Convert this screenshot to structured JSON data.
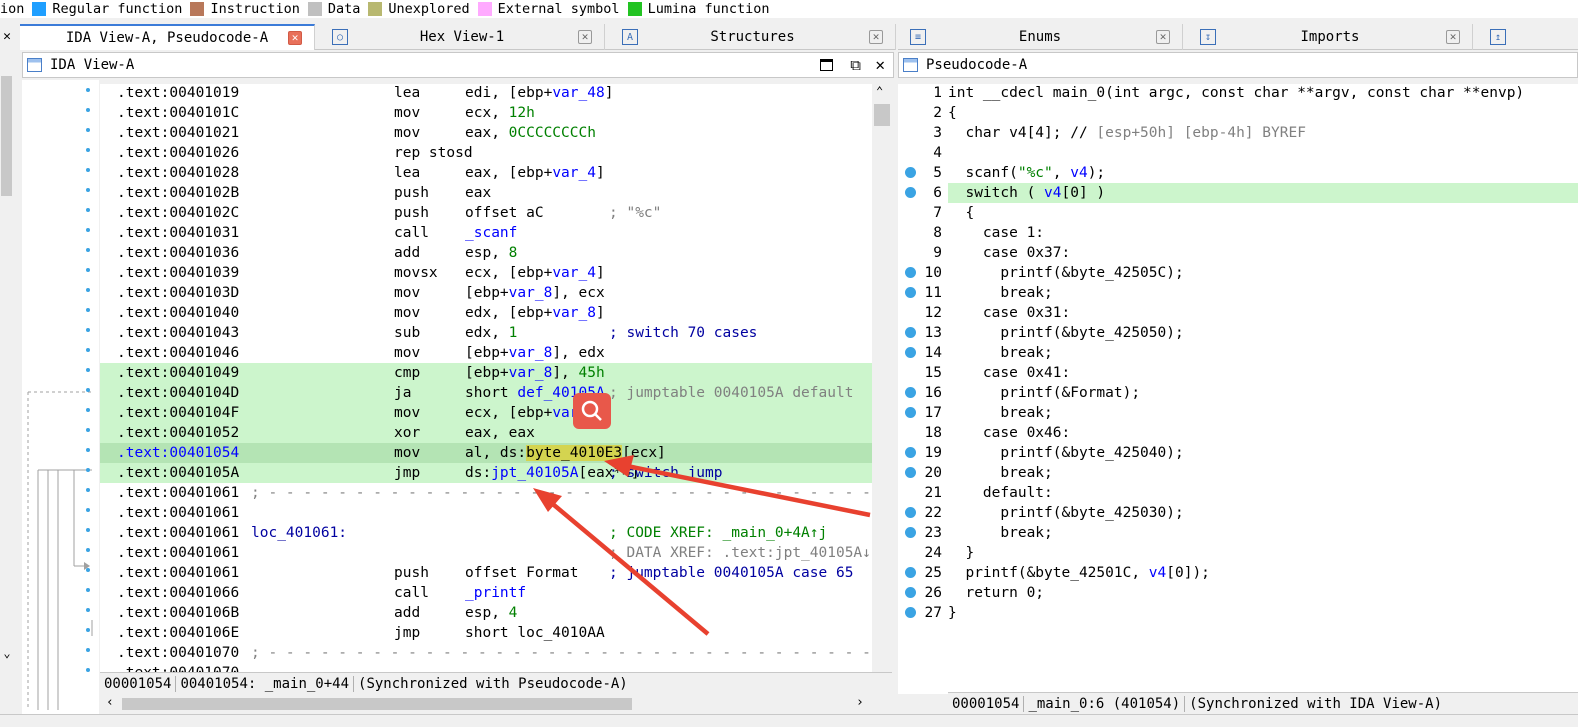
{
  "legend": [
    {
      "label": "ion",
      "color": ""
    },
    {
      "label": "Regular function",
      "color": "#1f9fff"
    },
    {
      "label": "Instruction",
      "color": "#b8785a"
    },
    {
      "label": "Data",
      "color": "#c0c0c0"
    },
    {
      "label": "Unexplored",
      "color": "#b8b870"
    },
    {
      "label": "External symbol",
      "color": "#ffaaff"
    },
    {
      "label": "Lumina function",
      "color": "#22c322"
    }
  ],
  "left_tabs": [
    {
      "label": "IDA View-A, Pseudocode-A",
      "active": true
    },
    {
      "label": "Hex View-1",
      "active": false
    },
    {
      "label": "Structures",
      "active": false
    }
  ],
  "right_tabs": [
    {
      "label": "Enums"
    },
    {
      "label": "Imports"
    }
  ],
  "ida_view": {
    "title": "IDA View-A",
    "lines": [
      {
        "addr": ".text:00401019",
        "label": "",
        "mn": "lea",
        "op": [
          [
            "edi, [ebp+",
            ""
          ],
          [
            "var_48",
            "blue"
          ],
          [
            "]",
            ""
          ]
        ],
        "cmt": []
      },
      {
        "addr": ".text:0040101C",
        "label": "",
        "mn": "mov",
        "op": [
          [
            "ecx, ",
            ""
          ],
          [
            "12h",
            "green"
          ]
        ],
        "cmt": []
      },
      {
        "addr": ".text:00401021",
        "label": "",
        "mn": "mov",
        "op": [
          [
            "eax, ",
            ""
          ],
          [
            "0CCCCCCCCh",
            "green"
          ]
        ],
        "cmt": []
      },
      {
        "addr": ".text:00401026",
        "label": "",
        "mn": "rep stosd",
        "op": [],
        "cmt": []
      },
      {
        "addr": ".text:00401028",
        "label": "",
        "mn": "lea",
        "op": [
          [
            "eax, [ebp+",
            ""
          ],
          [
            "var_4",
            "blue"
          ],
          [
            "]",
            ""
          ]
        ],
        "cmt": []
      },
      {
        "addr": ".text:0040102B",
        "label": "",
        "mn": "push",
        "op": [
          [
            "eax",
            ""
          ]
        ],
        "cmt": []
      },
      {
        "addr": ".text:0040102C",
        "label": "",
        "mn": "push",
        "op": [
          [
            "offset aC",
            ""
          ]
        ],
        "cmt": [
          [
            "; \"%c\"",
            "gray"
          ]
        ]
      },
      {
        "addr": ".text:00401031",
        "label": "",
        "mn": "call",
        "op": [
          [
            "_scanf",
            "blue"
          ]
        ],
        "cmt": []
      },
      {
        "addr": ".text:00401036",
        "label": "",
        "mn": "add",
        "op": [
          [
            "esp, ",
            ""
          ],
          [
            "8",
            "green"
          ]
        ],
        "cmt": []
      },
      {
        "addr": ".text:00401039",
        "label": "",
        "mn": "movsx",
        "op": [
          [
            "ecx, [ebp+",
            ""
          ],
          [
            "var_4",
            "blue"
          ],
          [
            "]",
            ""
          ]
        ],
        "cmt": []
      },
      {
        "addr": ".text:0040103D",
        "label": "",
        "mn": "mov",
        "op": [
          [
            "[ebp+",
            ""
          ],
          [
            "var_8",
            "blue"
          ],
          [
            "], ecx",
            ""
          ]
        ],
        "cmt": []
      },
      {
        "addr": ".text:00401040",
        "label": "",
        "mn": "mov",
        "op": [
          [
            "edx, [ebp+",
            ""
          ],
          [
            "var_8",
            "blue"
          ],
          [
            "]",
            ""
          ]
        ],
        "cmt": []
      },
      {
        "addr": ".text:00401043",
        "label": "",
        "mn": "sub",
        "op": [
          [
            "edx, ",
            ""
          ],
          [
            "1",
            "green"
          ]
        ],
        "cmt": [
          [
            "; switch 70 cases",
            "navy"
          ]
        ]
      },
      {
        "addr": ".text:00401046",
        "label": "",
        "mn": "mov",
        "op": [
          [
            "[ebp+",
            ""
          ],
          [
            "var_8",
            "blue"
          ],
          [
            "], edx",
            ""
          ]
        ],
        "cmt": []
      },
      {
        "addr": ".text:00401049",
        "label": "",
        "mn": "cmp",
        "op": [
          [
            "[ebp+",
            ""
          ],
          [
            "var_8",
            "blue"
          ],
          [
            "], ",
            ""
          ],
          [
            "45h",
            "green"
          ]
        ],
        "cmt": [],
        "hl": "green"
      },
      {
        "addr": ".text:0040104D",
        "label": "",
        "mn": "ja",
        "op": [
          [
            "short ",
            ""
          ],
          [
            "def_40105A",
            "blue"
          ]
        ],
        "cmt": [
          [
            "; jumptable 0040105A default",
            "gray"
          ]
        ],
        "hl": "green"
      },
      {
        "addr": ".text:0040104F",
        "label": "",
        "mn": "mov",
        "op": [
          [
            "ecx, [ebp+",
            ""
          ],
          [
            "var_8",
            "blue"
          ],
          [
            "]",
            ""
          ]
        ],
        "cmt": [],
        "hl": "green"
      },
      {
        "addr": ".text:00401052",
        "label": "",
        "mn": "xor",
        "op": [
          [
            "eax, eax",
            ""
          ]
        ],
        "cmt": [],
        "hl": "green"
      },
      {
        "addr": ".text:00401054",
        "label": "",
        "mn": "mov",
        "op": [
          [
            "al, ds:",
            ""
          ],
          [
            "byte_4010E3",
            "yellow"
          ],
          [
            "[ecx]",
            ""
          ]
        ],
        "cmt": [],
        "hl": "cur"
      },
      {
        "addr": ".text:0040105A",
        "label": "",
        "mn": "jmp",
        "op": [
          [
            "ds:",
            ""
          ],
          [
            "jpt_40105A",
            "blue"
          ],
          [
            "[eax*4]",
            ""
          ]
        ],
        "cmt": [
          [
            "; switch jump",
            "navy"
          ]
        ],
        "hl": "green"
      },
      {
        "addr": ".text:00401061",
        "label": "",
        "mn": "",
        "op": [],
        "cmt": [],
        "sep": true
      },
      {
        "addr": ".text:00401061",
        "label": "",
        "mn": "",
        "op": [],
        "cmt": []
      },
      {
        "addr": ".text:00401061",
        "label": "loc_401061:",
        "mn": "",
        "op": [],
        "cmt": [
          [
            "; CODE XREF: _main_0+4A↑j",
            "green"
          ]
        ]
      },
      {
        "addr": ".text:00401061",
        "label": "",
        "mn": "",
        "op": [],
        "cmt": [
          [
            "; DATA XREF: .text:jpt_40105A↓",
            "gray"
          ]
        ]
      },
      {
        "addr": ".text:00401061",
        "label": "",
        "mn": "push",
        "op": [
          [
            "offset Format",
            ""
          ]
        ],
        "cmt": [
          [
            "; jumptable 0040105A case 65",
            "navy"
          ]
        ]
      },
      {
        "addr": ".text:00401066",
        "label": "",
        "mn": "call",
        "op": [
          [
            "_printf",
            "blue"
          ]
        ],
        "cmt": []
      },
      {
        "addr": ".text:0040106B",
        "label": "",
        "mn": "add",
        "op": [
          [
            "esp, ",
            ""
          ],
          [
            "4",
            "green"
          ]
        ],
        "cmt": []
      },
      {
        "addr": ".text:0040106E",
        "label": "",
        "mn": "jmp",
        "op": [
          [
            "short loc_4010AA",
            ""
          ]
        ],
        "cmt": []
      },
      {
        "addr": ".text:00401070",
        "label": "",
        "mn": "",
        "op": [],
        "cmt": [],
        "sep": true
      },
      {
        "addr": ".text:00401070",
        "label": "",
        "mn": "",
        "op": [],
        "cmt": []
      }
    ],
    "status": [
      "00001054",
      "00401054: _main_0+44",
      "(Synchronized with Pseudocode-A)"
    ]
  },
  "pseudo_view": {
    "title": "Pseudocode-A",
    "lines": [
      {
        "n": "1",
        "bp": false,
        "parts": [
          [
            "int __cdecl main_0(int argc, const char **argv, const char **envp)",
            ""
          ]
        ]
      },
      {
        "n": "2",
        "bp": false,
        "parts": [
          [
            "{",
            ""
          ]
        ]
      },
      {
        "n": "3",
        "bp": false,
        "parts": [
          [
            "  char v4[4]; // ",
            ""
          ],
          [
            "[esp+50h] [ebp-4h] BYREF",
            "gray"
          ]
        ]
      },
      {
        "n": "4",
        "bp": false,
        "parts": []
      },
      {
        "n": "5",
        "bp": true,
        "parts": [
          [
            "  scanf(",
            ""
          ],
          [
            "\"%c\"",
            "green"
          ],
          [
            ", ",
            ""
          ],
          [
            "v4",
            "blue"
          ],
          [
            ");",
            ""
          ]
        ]
      },
      {
        "n": "6",
        "bp": true,
        "hl": true,
        "parts": [
          [
            "  switch ( ",
            ""
          ],
          [
            "v4",
            "blue"
          ],
          [
            "[0] )",
            ""
          ]
        ]
      },
      {
        "n": "7",
        "bp": false,
        "parts": [
          [
            "  {",
            ""
          ]
        ]
      },
      {
        "n": "8",
        "bp": false,
        "parts": [
          [
            "    case 1:",
            ""
          ]
        ]
      },
      {
        "n": "9",
        "bp": false,
        "parts": [
          [
            "    case 0x37:",
            ""
          ]
        ]
      },
      {
        "n": "10",
        "bp": true,
        "parts": [
          [
            "      printf(&byte_42505C);",
            ""
          ]
        ]
      },
      {
        "n": "11",
        "bp": true,
        "parts": [
          [
            "      break;",
            ""
          ]
        ]
      },
      {
        "n": "12",
        "bp": false,
        "parts": [
          [
            "    case 0x31:",
            ""
          ]
        ]
      },
      {
        "n": "13",
        "bp": true,
        "parts": [
          [
            "      printf(&byte_425050);",
            ""
          ]
        ]
      },
      {
        "n": "14",
        "bp": true,
        "parts": [
          [
            "      break;",
            ""
          ]
        ]
      },
      {
        "n": "15",
        "bp": false,
        "parts": [
          [
            "    case 0x41:",
            ""
          ]
        ]
      },
      {
        "n": "16",
        "bp": true,
        "parts": [
          [
            "      printf(&Format);",
            ""
          ]
        ]
      },
      {
        "n": "17",
        "bp": true,
        "parts": [
          [
            "      break;",
            ""
          ]
        ]
      },
      {
        "n": "18",
        "bp": false,
        "parts": [
          [
            "    case 0x46:",
            ""
          ]
        ]
      },
      {
        "n": "19",
        "bp": true,
        "parts": [
          [
            "      printf(&byte_425040);",
            ""
          ]
        ]
      },
      {
        "n": "20",
        "bp": true,
        "parts": [
          [
            "      break;",
            ""
          ]
        ]
      },
      {
        "n": "21",
        "bp": false,
        "parts": [
          [
            "    default:",
            ""
          ]
        ]
      },
      {
        "n": "22",
        "bp": true,
        "parts": [
          [
            "      printf(&byte_425030);",
            ""
          ]
        ]
      },
      {
        "n": "23",
        "bp": true,
        "parts": [
          [
            "      break;",
            ""
          ]
        ]
      },
      {
        "n": "24",
        "bp": false,
        "parts": [
          [
            "  }",
            ""
          ]
        ]
      },
      {
        "n": "25",
        "bp": true,
        "parts": [
          [
            "  printf(&byte_42501C, ",
            ""
          ],
          [
            "v4",
            "blue"
          ],
          [
            "[0]);",
            ""
          ]
        ]
      },
      {
        "n": "26",
        "bp": true,
        "parts": [
          [
            "  return 0;",
            ""
          ]
        ]
      },
      {
        "n": "27",
        "bp": true,
        "parts": [
          [
            "}",
            ""
          ]
        ]
      }
    ],
    "status": [
      "00001054",
      "_main_0:6 (401054)",
      "(Synchronized with IDA View-A)"
    ]
  },
  "colors": {
    "highlight_green": "#ccf5cc",
    "highlight_current": "#b4e4b4",
    "accent_blue": "#0000ff",
    "arrow_red": "#e8412f"
  }
}
